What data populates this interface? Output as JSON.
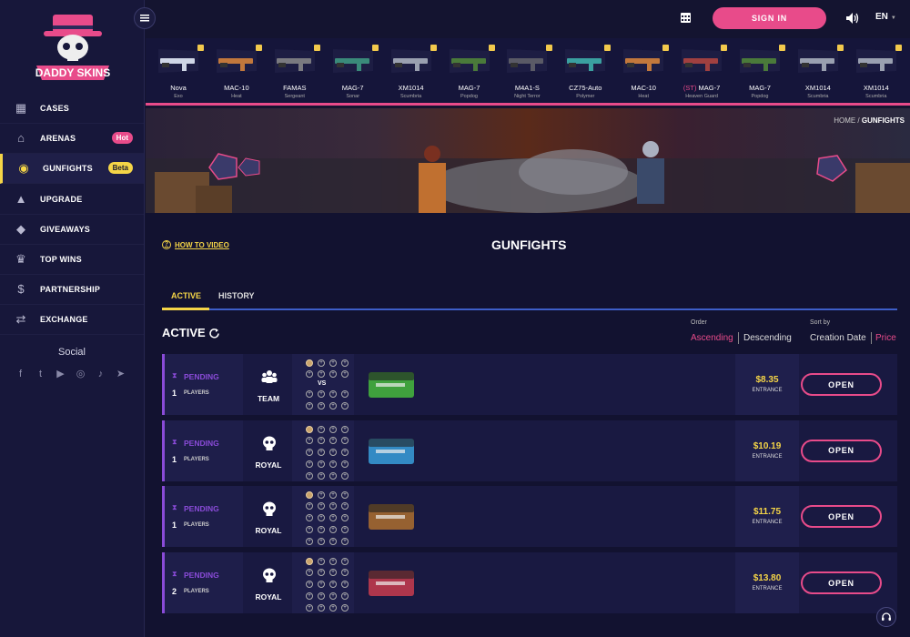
{
  "brand": {
    "name": "DADDY SKINS"
  },
  "nav": [
    {
      "label": "CASES",
      "icon": "cases-icon"
    },
    {
      "label": "ARENAS",
      "icon": "arena-icon",
      "badge": "Hot"
    },
    {
      "label": "GUNFIGHTS",
      "icon": "coin-icon",
      "badge": "Beta",
      "active": true
    },
    {
      "label": "UPGRADE",
      "icon": "upgrade-icon"
    },
    {
      "label": "GIVEAWAYS",
      "icon": "diamond-icon"
    },
    {
      "label": "TOP WINS",
      "icon": "trophy-icon"
    },
    {
      "label": "PARTNERSHIP",
      "icon": "dollar-icon"
    },
    {
      "label": "EXCHANGE",
      "icon": "exchange-icon"
    }
  ],
  "social": {
    "title": "Social",
    "links": [
      "facebook-icon",
      "twitter-icon",
      "youtube-icon",
      "instagram-icon",
      "tiktok-icon",
      "telegram-icon"
    ]
  },
  "header": {
    "signin": "SIGN IN",
    "lang": "EN"
  },
  "ticker": [
    {
      "name": "Nova",
      "skin": "Exo",
      "color": "#cfd6e6"
    },
    {
      "name": "MAC-10",
      "skin": "Heat",
      "color": "#c2783c"
    },
    {
      "name": "FAMAS",
      "skin": "Sergeant",
      "color": "#7a7a80"
    },
    {
      "name": "MAG-7",
      "skin": "Sonar",
      "color": "#3a8a7a"
    },
    {
      "name": "XM1014",
      "skin": "Scumbria",
      "color": "#9aa0b0"
    },
    {
      "name": "MAG-7",
      "skin": "Popdog",
      "color": "#4a7a3a"
    },
    {
      "name": "M4A1-S",
      "skin": "Night Terror",
      "color": "#5a5a66"
    },
    {
      "name": "CZ75-Auto",
      "skin": "Polymer",
      "color": "#3aa0a0"
    },
    {
      "name": "MAC-10",
      "skin": "Heat",
      "color": "#c2783c"
    },
    {
      "name": "MAG-7",
      "skin": "Heaven Guard",
      "st": "(ST)",
      "color": "#a04040"
    },
    {
      "name": "MAG-7",
      "skin": "Popdog",
      "color": "#4a7a3a"
    },
    {
      "name": "XM1014",
      "skin": "Scumbria",
      "color": "#9aa0b0"
    },
    {
      "name": "XM1014",
      "skin": "Scumbria",
      "color": "#9aa0b0"
    }
  ],
  "breadcrumb": {
    "home": "HOME",
    "sep": "/",
    "current": "GUNFIGHTS"
  },
  "page": {
    "howto": "HOW TO VIDEO",
    "title": "GUNFIGHTS",
    "tabs": [
      "ACTIVE",
      "HISTORY"
    ],
    "section": "ACTIVE",
    "order": {
      "label": "Order",
      "asc": "Ascending",
      "desc": "Descending"
    },
    "sort": {
      "label": "Sort by",
      "date": "Creation Date",
      "price": "Price"
    }
  },
  "games": [
    {
      "status": "PENDING",
      "count": "1",
      "players_label": "PLAYERS",
      "mode": "TEAM",
      "vs": "VS",
      "price": "$8.35",
      "entrance": "ENTRANCE",
      "open": "OPEN",
      "case_color": "#4ccf3c"
    },
    {
      "status": "PENDING",
      "count": "1",
      "players_label": "PLAYERS",
      "mode": "ROYAL",
      "price": "$10.19",
      "entrance": "ENTRANCE",
      "open": "OPEN",
      "case_color": "#3cb0f0"
    },
    {
      "status": "PENDING",
      "count": "1",
      "players_label": "PLAYERS",
      "mode": "ROYAL",
      "price": "$11.75",
      "entrance": "ENTRANCE",
      "open": "OPEN",
      "case_color": "#c07a2c"
    },
    {
      "status": "PENDING",
      "count": "2",
      "players_label": "PLAYERS",
      "mode": "ROYAL",
      "price": "$13.80",
      "entrance": "ENTRANCE",
      "open": "OPEN",
      "case_color": "#e04050"
    }
  ]
}
